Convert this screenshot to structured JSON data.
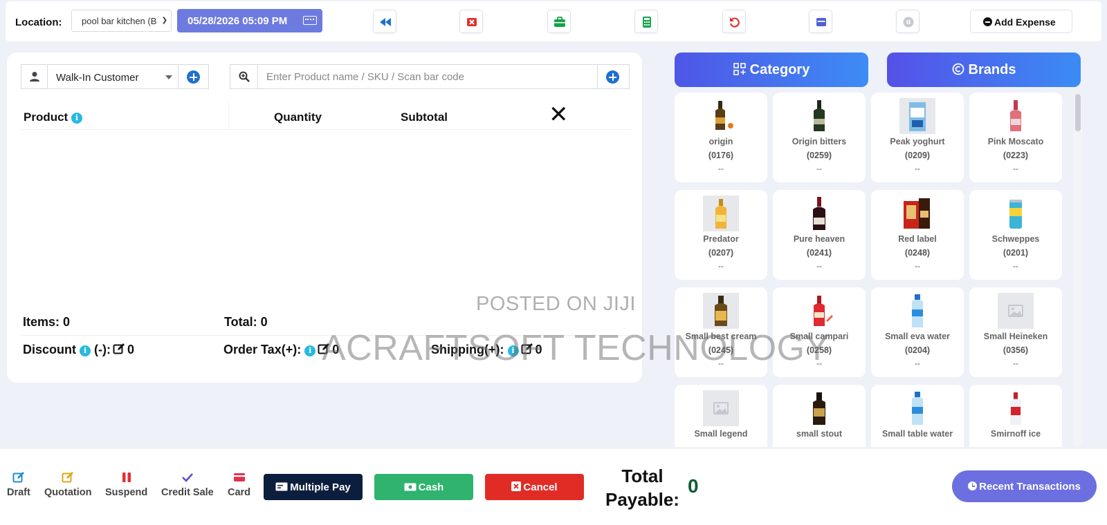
{
  "header": {
    "location_label": "Location:",
    "location_value": "pool bar kitchen (B",
    "datetime": "05/28/2026 05:09 PM",
    "add_expense_label": "Add Expense"
  },
  "customer": {
    "selected": "Walk-In Customer"
  },
  "search": {
    "placeholder": "Enter Product name / SKU / Scan bar code"
  },
  "cart": {
    "columns": {
      "product": "Product",
      "quantity": "Quantity",
      "subtotal": "Subtotal"
    },
    "items_label": "Items:",
    "items_value": "0",
    "total_label": "Total:",
    "total_value": "0",
    "discount_label": "Discount",
    "discount_suffix": "(-):",
    "discount_value": "0",
    "order_tax_label": "Order Tax(+):",
    "order_tax_value": "0",
    "shipping_label": "Shipping(+):",
    "shipping_value": "0"
  },
  "filters": {
    "category_label": "Category",
    "brands_label": "Brands"
  },
  "products": [
    {
      "name": "origin",
      "sku": "(0176)",
      "price": "--",
      "thumb": "brown-bottle"
    },
    {
      "name": "Origin bitters",
      "sku": "(0259)",
      "price": "--",
      "thumb": "dark-bottle"
    },
    {
      "name": "Peak yoghurt",
      "sku": "(0209)",
      "price": "--",
      "thumb": "yoghurt-carton"
    },
    {
      "name": "Pink Moscato",
      "sku": "(0223)",
      "price": "--",
      "thumb": "pink-bottle"
    },
    {
      "name": "Predator",
      "sku": "(0207)",
      "price": "--",
      "thumb": "yellow-bottle"
    },
    {
      "name": "Pure heaven",
      "sku": "(0241)",
      "price": "--",
      "thumb": "wine-bottle"
    },
    {
      "name": "Red label",
      "sku": "(0248)",
      "price": "--",
      "thumb": "whisky-box"
    },
    {
      "name": "Schweppes",
      "sku": "(0201)",
      "price": "--",
      "thumb": "can"
    },
    {
      "name": "Small best cream",
      "sku": "(0245)",
      "price": "--",
      "thumb": "cream-bottle"
    },
    {
      "name": "Small campari",
      "sku": "(0258)",
      "price": "--",
      "thumb": "campari-bottle"
    },
    {
      "name": "Small eva water",
      "sku": "(0204)",
      "price": "--",
      "thumb": "water-bottle"
    },
    {
      "name": "Small Heineken",
      "sku": "(0356)",
      "price": "--",
      "thumb": "placeholder-image"
    },
    {
      "name": "Small legend",
      "sku": "",
      "price": "",
      "thumb": "placeholder-image"
    },
    {
      "name": "small stout",
      "sku": "",
      "price": "",
      "thumb": "stout-bottle"
    },
    {
      "name": "Small table water",
      "sku": "",
      "price": "",
      "thumb": "water-bottle"
    },
    {
      "name": "Smirnoff ice",
      "sku": "",
      "price": "",
      "thumb": "smirnoff-bottle"
    }
  ],
  "watermark": {
    "line1": "POSTED ON JIJI",
    "line2": "ACRAFTSOFT TECHNOLOGY"
  },
  "footer": {
    "draft_label": "Draft",
    "quotation_label": "Quotation",
    "suspend_label": "Suspend",
    "credit_sale_label": "Credit Sale",
    "card_label": "Card",
    "multiple_pay_label": "Multiple Pay",
    "cash_label": "Cash",
    "cancel_label": "Cancel",
    "total_payable_line1": "Total",
    "total_payable_line2": "Payable:",
    "total_payable_value": "0",
    "recent_transactions_label": "Recent Transactions"
  },
  "colors": {
    "accent": "#6d7be0",
    "multiple_pay": "#0c1e3d",
    "cash": "#2fb36e",
    "cancel": "#e12c25",
    "total_value": "#0d5c36"
  }
}
